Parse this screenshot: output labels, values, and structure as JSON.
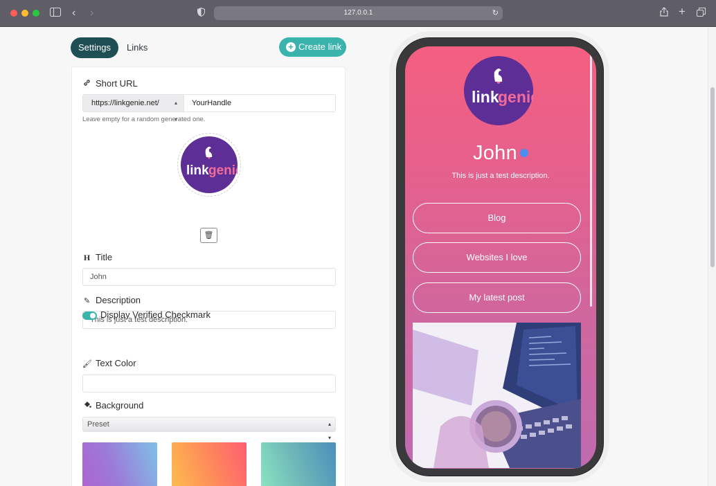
{
  "browser": {
    "url": "127.0.0.1"
  },
  "tabs": {
    "settings": "Settings",
    "links": "Links"
  },
  "create_button": "Create link",
  "short_url": {
    "label": "Short URL",
    "prefix": "https://linkgenie.net/",
    "handle": "YourHandle",
    "hint": "Leave empty for a random generated one."
  },
  "logo": {
    "text_link": "link",
    "text_genie": "genie"
  },
  "title": {
    "label": "Title",
    "value": "John"
  },
  "description": {
    "label": "Description",
    "value": "This is just a test description."
  },
  "verified": {
    "label": "Display Verified Checkmark",
    "enabled": true
  },
  "text_color": {
    "label": "Text Color",
    "value": ""
  },
  "background": {
    "label": "Background",
    "select_value": "Preset",
    "swatches": [
      "#b05fd0",
      "#fe8a5a",
      "#6fb8b8"
    ]
  },
  "preview": {
    "name": "John",
    "description": "This is just a test description.",
    "links": [
      "Blog",
      "Websites I love",
      "My latest post"
    ]
  },
  "colors": {
    "accent": "#3ab3ad",
    "dark_tab": "#1f4f55",
    "brand_purple": "#5d2f96"
  }
}
